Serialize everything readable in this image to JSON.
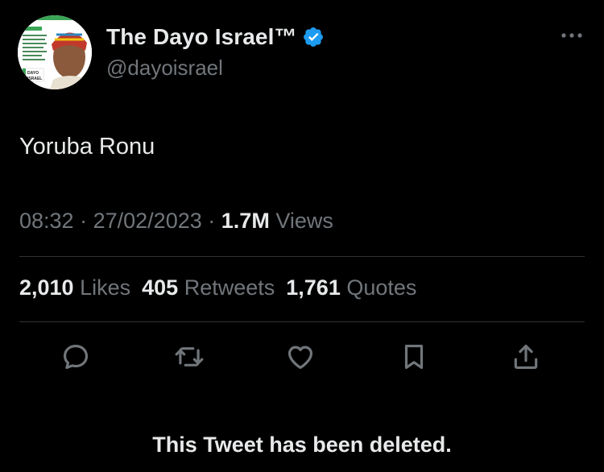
{
  "author": {
    "display_name": "The Dayo Israel™",
    "handle": "@dayoisrael",
    "avatar_badge_text": "DAYO ISRAEL"
  },
  "tweet": {
    "text": "Yoruba Ronu",
    "time": "08:32",
    "date": "27/02/2023",
    "separator": "·",
    "views_count": "1.7M",
    "views_label": "Views"
  },
  "stats": {
    "likes_count": "2,010",
    "likes_label": "Likes",
    "retweets_count": "405",
    "retweets_label": "Retweets",
    "quotes_count": "1,761",
    "quotes_label": "Quotes"
  },
  "actions": [
    "reply-icon",
    "retweet-icon",
    "like-icon",
    "bookmark-icon",
    "share-icon"
  ],
  "notice": {
    "text": "This Tweet has been deleted."
  },
  "colors": {
    "background": "#000000",
    "primary_text": "#e7e9ea",
    "secondary_text": "#71767b",
    "divider": "#2f3336",
    "verified_blue": "#1d9bf0"
  }
}
